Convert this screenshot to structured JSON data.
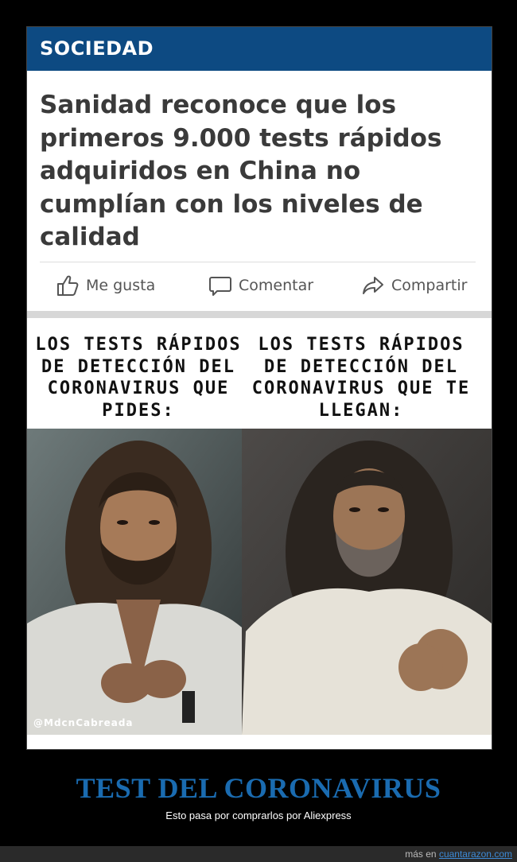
{
  "article": {
    "section": "SOCIEDAD",
    "headline": "Sanidad reconoce que los primeros 9.000 tests rápidos adquiridos en China no cumplían con los niveles de calidad",
    "actions": {
      "like": "Me gusta",
      "comment": "Comentar",
      "share": "Compartir"
    }
  },
  "meme": {
    "left_text": "LOS TESTS RÁPIDOS DE DETECCIÓN DEL CORONAVIRUS QUE PIDES:",
    "right_text": "LOS TESTS RÁPIDOS DE DETECCIÓN DEL CORONAVIRUS QUE TE LLEGAN:",
    "watermark": "@MdcnCabreada"
  },
  "caption": {
    "title": "TEST DEL CORONAVIRUS",
    "subtitle": "Esto pasa por comprarlos por Aliexpress"
  },
  "footer": {
    "prefix": "más en",
    "site": "cuantarazon.com"
  },
  "colors": {
    "banner": "#0d4a82",
    "caption_title": "#1a6bb0",
    "link": "#3d8ad6"
  }
}
